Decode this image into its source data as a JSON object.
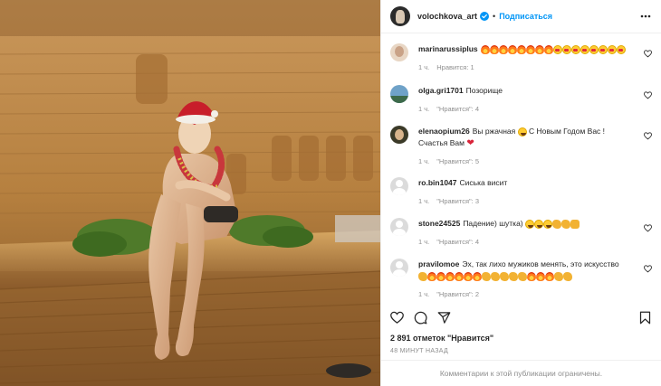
{
  "header": {
    "username": "volochkova_art",
    "dot": "•",
    "follow_label": "Подписаться"
  },
  "comments": [
    {
      "username": "marinarussiplus",
      "text": "",
      "emojis": [
        "fire",
        "fire",
        "fire",
        "fire",
        "fire",
        "fire",
        "fire",
        "fire",
        "face",
        "face",
        "face",
        "face",
        "face",
        "face",
        "face",
        "face"
      ],
      "time": "1 ч.",
      "likes": "Нравится: 1"
    },
    {
      "username": "olga.gri1701",
      "text": "Позорище",
      "emojis": [],
      "time": "1 ч.",
      "likes": "\"Нравится\": 4"
    },
    {
      "username": "elenaopium26",
      "text": "Вы ржачная",
      "text2": "С Новым Годом Вас ! Счастья Вам",
      "emojis": [
        "laugh"
      ],
      "emojis_end": [
        "heart"
      ],
      "time": "1 ч.",
      "likes": "\"Нравится\": 5"
    },
    {
      "username": "ro.bin1047",
      "text": "Сиська висит",
      "emojis": [],
      "time": "1 ч.",
      "likes": "\"Нравится\": 3"
    },
    {
      "username": "stone24525",
      "text": "Падение) шутка)",
      "emojis": [
        "laugh",
        "laugh",
        "laugh",
        "clap",
        "clap",
        "hands"
      ],
      "time": "1 ч.",
      "likes": "\"Нравится\": 4"
    },
    {
      "username": "pravilomoe",
      "text": "Эх, так лихо мужиков менять, это искусство",
      "emojis": [
        "clap",
        "fire",
        "fire",
        "fire",
        "fire",
        "fire",
        "fire",
        "clap",
        "clap",
        "clap",
        "clap",
        "clap",
        "fire",
        "fire",
        "fire",
        "clap",
        "clap"
      ],
      "time": "1 ч.",
      "likes": "\"Нравится\": 2"
    }
  ],
  "likes_count": "2 891 отметок \"Нравится\"",
  "timestamp": "48 МИНУТ НАЗАД",
  "footer_text": "Комментарии к этой публикации ограничены.",
  "colors": {
    "accent": "#0095f6",
    "muted": "#8e8e8e",
    "text": "#262626"
  }
}
